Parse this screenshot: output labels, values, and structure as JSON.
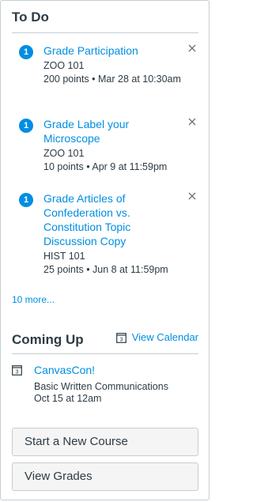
{
  "todo": {
    "title": "To Do",
    "items": [
      {
        "badge": "1",
        "title": "Grade Participation",
        "course": "ZOO 101",
        "meta": "200 points • Mar 28 at 10:30am"
      },
      {
        "badge": "1",
        "title": "Grade Label your Microscope",
        "course": "ZOO 101",
        "meta": "10 points • Apr 9 at 11:59pm"
      },
      {
        "badge": "1",
        "title": "Grade Articles of Confederation vs. Constitution Topic Discussion Copy",
        "course": "HIST 101",
        "meta": "25 points • Jun 8 at 11:59pm"
      }
    ],
    "more_link": "10 more..."
  },
  "coming_up": {
    "title": "Coming Up",
    "view_calendar": "View Calendar",
    "calendar_icon_day": "3",
    "items": [
      {
        "icon_day": "3",
        "title": "CanvasCon!",
        "course": "Basic Written Communications",
        "date": "Oct 15 at 12am"
      }
    ]
  },
  "buttons": {
    "start_course": "Start a New Course",
    "view_grades": "View Grades"
  },
  "colors": {
    "link": "#008ee2",
    "text": "#2d3b45",
    "border": "#c7cdd1"
  }
}
